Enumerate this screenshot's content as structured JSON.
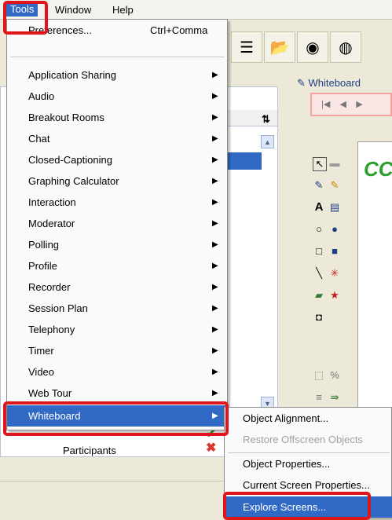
{
  "menubar": {
    "tools": "Tools",
    "window": "Window",
    "help": "Help"
  },
  "tools_menu": {
    "items": [
      {
        "label": "Preferences...",
        "accel": "Ctrl+Comma"
      },
      {
        "label": "Application Sharing"
      },
      {
        "label": "Audio"
      },
      {
        "label": "Breakout Rooms"
      },
      {
        "label": "Chat"
      },
      {
        "label": "Closed-Captioning"
      },
      {
        "label": "Graphing Calculator"
      },
      {
        "label": "Interaction"
      },
      {
        "label": "Moderator"
      },
      {
        "label": "Polling"
      },
      {
        "label": "Profile"
      },
      {
        "label": "Recorder"
      },
      {
        "label": "Session Plan"
      },
      {
        "label": "Telephony"
      },
      {
        "label": "Timer"
      },
      {
        "label": "Video"
      },
      {
        "label": "Web Tour"
      },
      {
        "label": "Whiteboard"
      }
    ]
  },
  "whiteboard_submenu": {
    "items": [
      {
        "label": "Object Alignment...",
        "enabled": true
      },
      {
        "label": "Restore Offscreen Objects",
        "enabled": false
      },
      {
        "label": "Object Properties...",
        "enabled": true
      },
      {
        "label": "Current Screen Properties...",
        "enabled": true
      },
      {
        "label": "Explore Screens...",
        "enabled": true
      }
    ]
  },
  "background": {
    "participants_label": "Participants",
    "whiteboard_tab": "Whiteboard",
    "canvas_text": "CCC"
  },
  "colors": {
    "selection": "#316ac5",
    "highlight": "#e0151b"
  }
}
